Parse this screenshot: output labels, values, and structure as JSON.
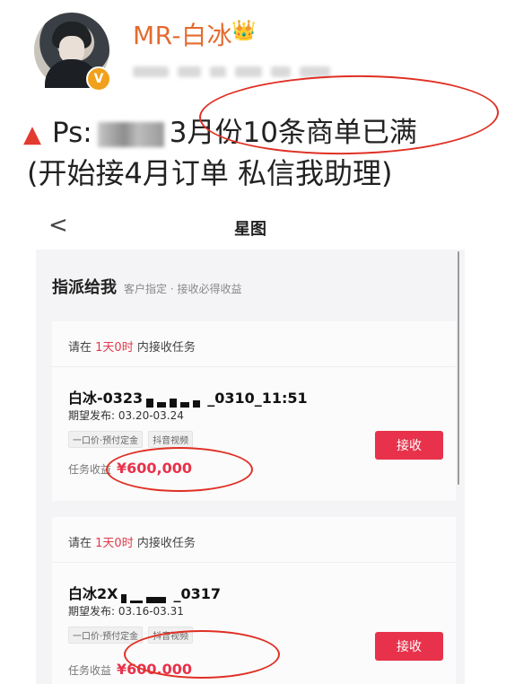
{
  "post": {
    "username": "MR-白冰",
    "crown_icon": "👑",
    "verified_badge": "V",
    "line1_prefix": "Ps:",
    "line1_text": "3月份10条商单已满",
    "line2_text": "(开始接4月订单 私信我助理)",
    "accent_color": "#e03024"
  },
  "app": {
    "back_glyph": "<",
    "title": "星图",
    "section_title": "指派给我",
    "section_subtitle": "客户指定 · 接收必得收益",
    "accept_color": "#e8324b",
    "cards": [
      {
        "deadline_prefix": "请在",
        "deadline_time": "1天0时",
        "deadline_suffix": "内接收任务",
        "task_prefix": "白冰-0323",
        "task_suffix": "_0310_11:51",
        "date": "期望发布: 03.20-03.24",
        "tags": [
          "一口价·预付定金",
          "抖音视频"
        ],
        "accept_label": "接收",
        "income_label": "任务收益",
        "income_amount": "¥600,000"
      },
      {
        "deadline_prefix": "请在",
        "deadline_time": "1天0时",
        "deadline_suffix": "内接收任务",
        "task_prefix": "白冰2X",
        "task_suffix": "_0317",
        "date": "期望发布: 03.16-03.31",
        "tags": [
          "一口价·预付定金",
          "抖音视频"
        ],
        "accept_label": "接收",
        "income_label": "任务收益",
        "income_amount": "¥600.000"
      }
    ]
  }
}
